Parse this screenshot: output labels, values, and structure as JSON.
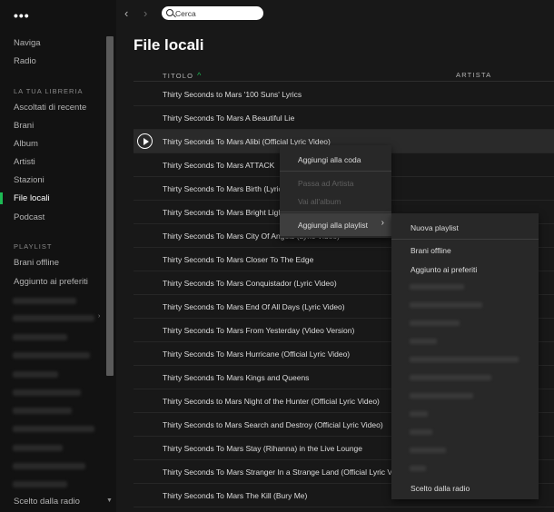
{
  "sidebar": {
    "dots": "•••",
    "nav": [
      {
        "label": "Naviga"
      },
      {
        "label": "Radio"
      }
    ],
    "library_title": "LA TUA LIBRERIA",
    "library": [
      {
        "label": "Ascoltati di recente"
      },
      {
        "label": "Brani"
      },
      {
        "label": "Album"
      },
      {
        "label": "Artisti"
      },
      {
        "label": "Stazioni"
      },
      {
        "label": "File locali"
      },
      {
        "label": "Podcast"
      }
    ],
    "playlist_title": "PLAYLIST",
    "playlists": [
      {
        "label": "Brani offline"
      },
      {
        "label": "Aggiunto ai preferiti"
      }
    ],
    "bottom_item": "Scelto dalla radio"
  },
  "topbar": {
    "back_icon": "‹",
    "forward_icon": "›",
    "search_placeholder": "Cerca"
  },
  "main": {
    "title": "File locali",
    "columns": {
      "title": "TITOLO",
      "artist": "ARTISTA"
    },
    "tracks": [
      "Thirty Seconds to Mars '100 Suns' Lyrics",
      "Thirty Seconds To Mars A Beautiful Lie",
      "Thirty Seconds To Mars Alibi (Official Lyric Video)",
      "Thirty Seconds To Mars ATTACK",
      "Thirty Seconds To Mars Birth (Lyric Video)",
      "Thirty Seconds To Mars Bright Lights",
      "Thirty Seconds To Mars City Of Angels (Lyric Video)",
      "Thirty Seconds To Mars Closer To The Edge",
      "Thirty Seconds To Mars Conquistador (Lyric Video)",
      "Thirty Seconds To Mars End Of All Days (Lyric Video)",
      "Thirty Seconds To Mars From Yesterday (Video Version)",
      "Thirty Seconds To Mars Hurricane (Official Lyric Video)",
      "Thirty Seconds To Mars Kings and Queens",
      "Thirty Seconds to Mars Night of the Hunter (Official Lyric Video)",
      "Thirty Seconds to Mars Search and Destroy (Official Lyric Video)",
      "Thirty Seconds To Mars Stay (Rihanna) in the Live Lounge",
      "Thirty Seconds To Mars Stranger In a Strange Land (Official Lyric Video)",
      "Thirty Seconds To Mars The Kill (Bury Me)"
    ]
  },
  "context_menu": {
    "add_to_queue": "Aggiungi alla coda",
    "go_to_artist": "Passa ad Artista",
    "go_to_album": "Vai all'album",
    "add_to_playlist": "Aggiungi alla playlist",
    "arrow": "›"
  },
  "playlist_submenu": {
    "new_playlist": "Nuova playlist",
    "offline": "Brani offline",
    "favorites": "Aggiunto ai preferiti",
    "radio": "Scelto dalla radio"
  },
  "colors": {
    "accent": "#1db954",
    "background": "#181818",
    "sidebar": "#121212",
    "menu": "#282828"
  }
}
